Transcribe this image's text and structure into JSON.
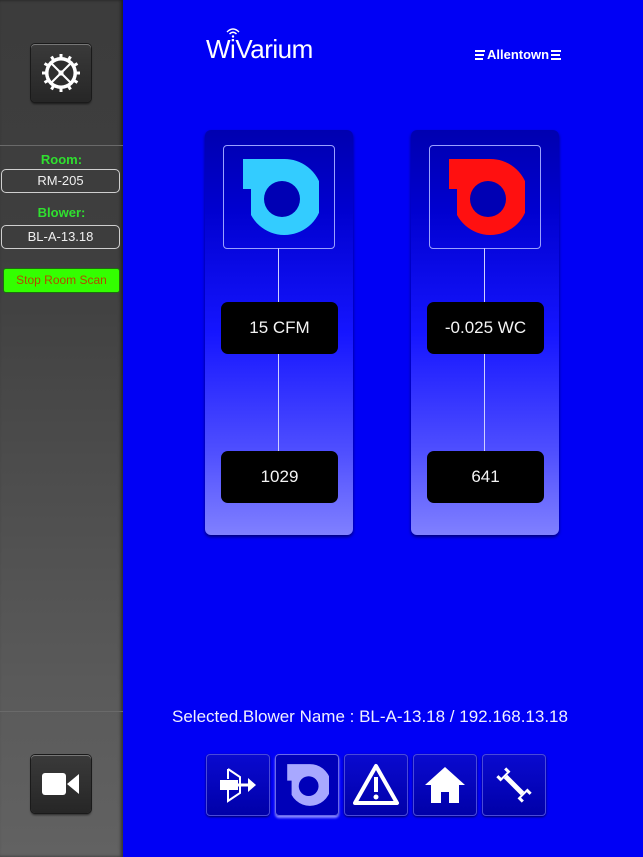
{
  "header": {
    "logo": "WiVarium",
    "brand": "Allentown"
  },
  "sidebar": {
    "room_label": "Room:",
    "room_value": "RM-205",
    "blower_label": "Blower:",
    "blower_value": "BL-A-13.18",
    "scan_button": "Stop Room Scan"
  },
  "panels": [
    {
      "name": "airflow",
      "icon_color": "#33ccff",
      "reading": "15  CFM",
      "count": "1029"
    },
    {
      "name": "pressure",
      "icon_color": "#ff1010",
      "reading": "-0.025  WC",
      "count": "641"
    }
  ],
  "status": {
    "text": "Selected.Blower Name : BL-A-13.18 / 192.168.13.18"
  },
  "toolbar": {
    "items": [
      {
        "icon": "exit-arrow-icon",
        "active": false
      },
      {
        "icon": "blower-icon",
        "active": true
      },
      {
        "icon": "warning-icon",
        "active": false
      },
      {
        "icon": "home-icon",
        "active": false
      },
      {
        "icon": "wrench-icon",
        "active": false
      }
    ]
  },
  "colors": {
    "background": "#0000f5",
    "accent_green": "#33ff00",
    "label_green": "#2fe02f"
  }
}
